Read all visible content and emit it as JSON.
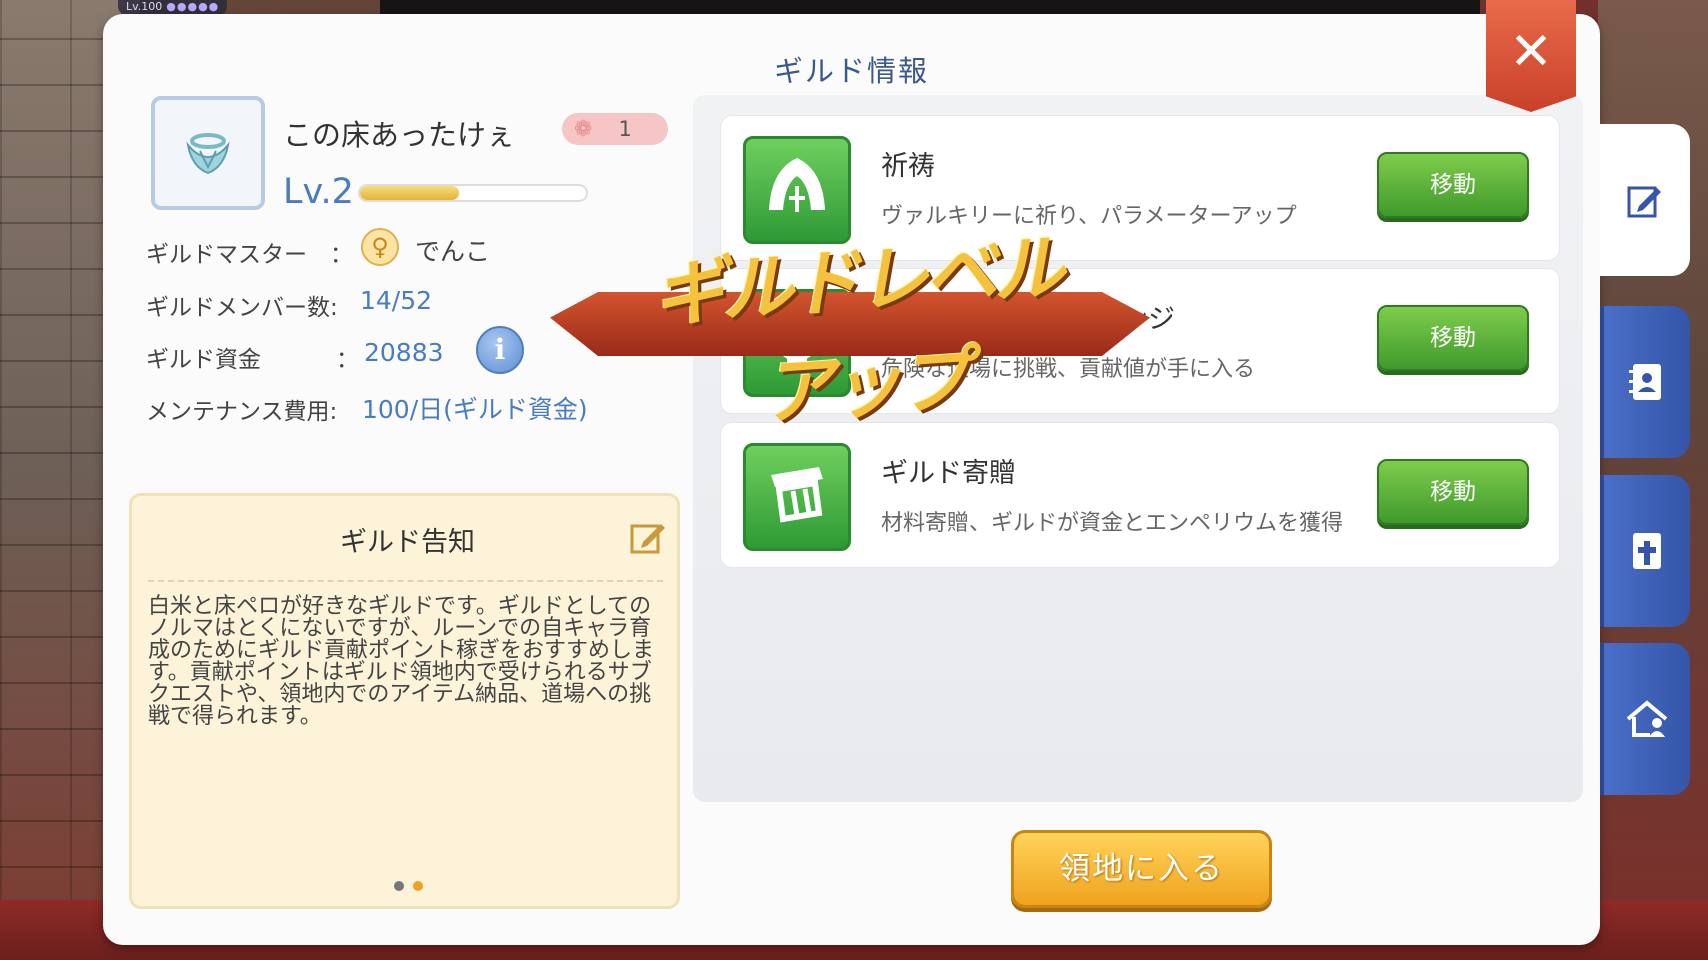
{
  "window": {
    "title": "ギルド情報"
  },
  "hud": {
    "level_text": "Lv.100",
    "dots": "●●●●●"
  },
  "guild": {
    "name": "この床あったけぇ",
    "rank_value": "1",
    "level_label": "Lv.2",
    "exp_progress": 0.44
  },
  "info": {
    "master_label": "ギルドマスター",
    "master_colon": "：",
    "master_name": "でんこ",
    "members_label": "ギルドメンバー数:",
    "members_value": "14/52",
    "funds_label": "ギルド資金",
    "funds_colon": "：",
    "funds_value": "20883",
    "maintenance_label": "メンテナンス費用:",
    "maintenance_value": "100/日(ギルド資金)"
  },
  "notice": {
    "title": "ギルド告知",
    "body": "白米と床ペロが好きなギルドです。ギルドとしてのノルマはとくにないですが、ルーンでの自キャラ育成のためにギルド貢献ポイント稼ぎをおすすめします。貢献ポイントはギルド領地内で受けられるサブクエストや、領地内でのアイテム納品、道場への挑戦で得られます。",
    "page_dots": 2,
    "active_dot": 1
  },
  "activities": [
    {
      "title": "祈祷",
      "desc": "ヴァルキリーに祈り、パラメーターアップ",
      "button": "移動",
      "icon": "valkyrie-icon"
    },
    {
      "title": "ンジ",
      "desc": "危険な道場に挑戦、貢献値が手に入る",
      "button": "移動",
      "icon": "skull-icon"
    },
    {
      "title": "ギルド寄贈",
      "desc": "材料寄贈、ギルドが資金とエンペリウムを獲得",
      "button": "移動",
      "icon": "donate-icon"
    }
  ],
  "banner": {
    "text": "ギルドレベルアップ"
  },
  "enter_button": "領地に入る",
  "side_tabs": [
    {
      "icon": "edit-icon",
      "active": true
    },
    {
      "icon": "member-list-icon",
      "active": false
    },
    {
      "icon": "cross-book-icon",
      "active": false
    },
    {
      "icon": "guild-house-icon",
      "active": false
    }
  ],
  "colors": {
    "accent_blue": "#4a7cc0",
    "title_blue": "#3b5a8c",
    "close_red": "#d24d33",
    "move_green": "#4fa836",
    "enter_orange": "#f5b83a"
  }
}
